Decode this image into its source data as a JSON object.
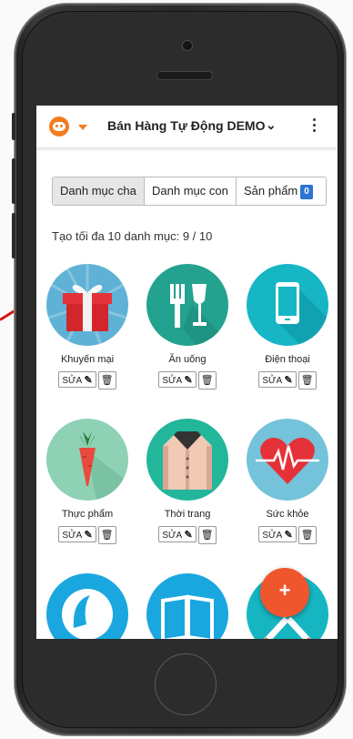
{
  "app": {
    "title": "Bán Hàng Tự Động DEMO",
    "chevron": "❯"
  },
  "tabs": [
    {
      "label": "Danh mục cha",
      "active": true
    },
    {
      "label": "Danh mục con",
      "active": false
    },
    {
      "label": "Sản phẩm",
      "badge": "0",
      "active": false
    }
  ],
  "limit_text": "Tạo tối đa 10 danh mục: 9 / 10",
  "categories": [
    {
      "name": "Khuyến mại",
      "icon": "gift-icon",
      "color": "#5fb2d6"
    },
    {
      "name": "Ăn uống",
      "icon": "utensils-icon",
      "color": "#23a28f"
    },
    {
      "name": "Điện thoại",
      "icon": "smartphone-icon",
      "color": "#17b6c5"
    },
    {
      "name": "Thực phẩm",
      "icon": "carrot-icon",
      "color": "#8ed1b4"
    },
    {
      "name": "Thời trang",
      "icon": "jacket-icon",
      "color": "#22b69a"
    },
    {
      "name": "Sức khỏe",
      "icon": "heartbeat-icon",
      "color": "#74c3da"
    },
    {
      "name": "",
      "icon": "woman-face-icon",
      "color": "#1aa7e0"
    },
    {
      "name": "",
      "icon": "book-icon",
      "color": "#1aa7e0"
    },
    {
      "name": "",
      "icon": "tools-icon",
      "color": "#16b5c2"
    }
  ],
  "actions": {
    "edit_label": "SỬA",
    "edit_icon": "✎",
    "delete_icon": "🗑"
  },
  "fab_label": "+"
}
